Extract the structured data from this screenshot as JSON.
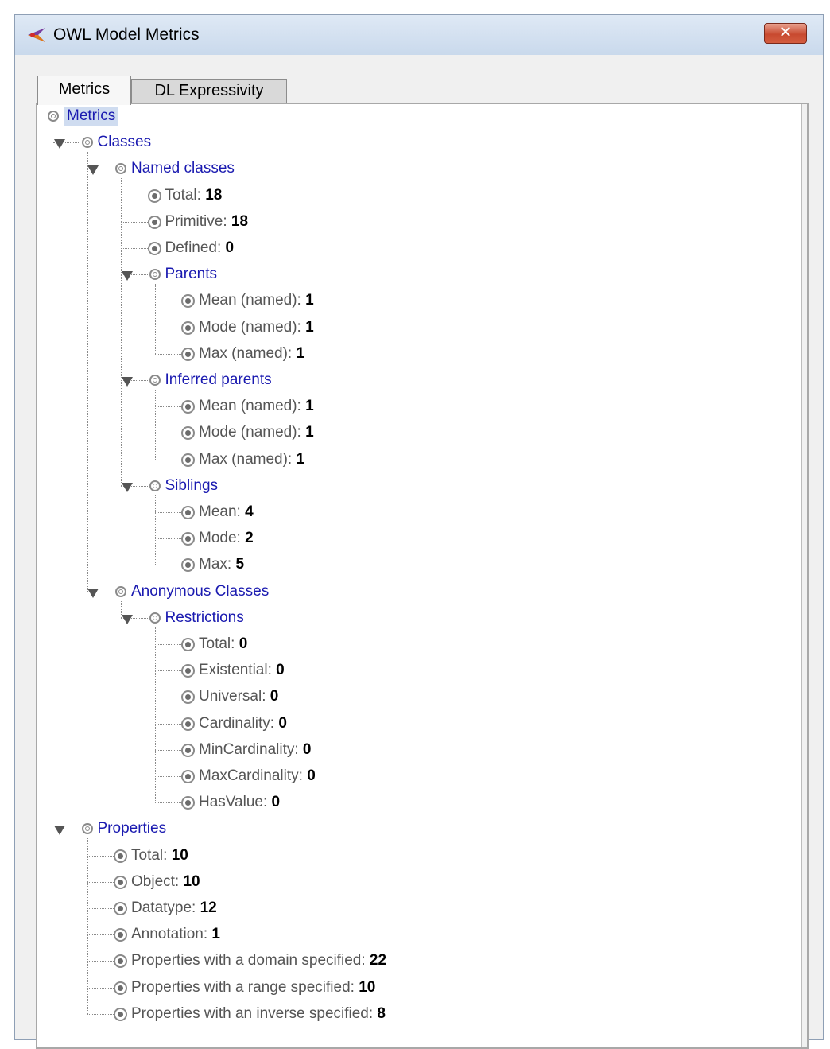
{
  "window": {
    "title": "OWL Model Metrics",
    "close_label": "✕",
    "accent_color": "#1a1ab0",
    "close_color": "#c84a30"
  },
  "tabs": [
    {
      "label": "Metrics",
      "active": true
    },
    {
      "label": "DL Expressivity",
      "active": false
    }
  ],
  "tree": [
    {
      "label": "Metrics",
      "type": "root"
    },
    {
      "label": "Classes",
      "type": "category",
      "expanded": true
    },
    {
      "label": "Named classes",
      "type": "category",
      "expanded": true
    },
    {
      "label": "Total:",
      "value": "18",
      "type": "metric"
    },
    {
      "label": "Primitive:",
      "value": "18",
      "type": "metric"
    },
    {
      "label": "Defined:",
      "value": "0",
      "type": "metric"
    },
    {
      "label": "Parents",
      "type": "category",
      "expanded": true
    },
    {
      "label": "Mean (named):",
      "value": "1",
      "type": "metric"
    },
    {
      "label": "Mode (named):",
      "value": "1",
      "type": "metric"
    },
    {
      "label": "Max (named):",
      "value": "1",
      "type": "metric"
    },
    {
      "label": "Inferred parents",
      "type": "category",
      "expanded": true
    },
    {
      "label": "Mean (named):",
      "value": "1",
      "type": "metric"
    },
    {
      "label": "Mode (named):",
      "value": "1",
      "type": "metric"
    },
    {
      "label": "Max (named):",
      "value": "1",
      "type": "metric"
    },
    {
      "label": "Siblings",
      "type": "category",
      "expanded": true
    },
    {
      "label": "Mean:",
      "value": "4",
      "type": "metric"
    },
    {
      "label": "Mode:",
      "value": "2",
      "type": "metric"
    },
    {
      "label": "Max:",
      "value": "5",
      "type": "metric"
    },
    {
      "label": "Anonymous Classes",
      "type": "category",
      "expanded": true
    },
    {
      "label": "Restrictions",
      "type": "category",
      "expanded": true
    },
    {
      "label": "Total:",
      "value": "0",
      "type": "metric"
    },
    {
      "label": "Existential:",
      "value": "0",
      "type": "metric"
    },
    {
      "label": "Universal:",
      "value": "0",
      "type": "metric"
    },
    {
      "label": "Cardinality:",
      "value": "0",
      "type": "metric"
    },
    {
      "label": "MinCardinality:",
      "value": "0",
      "type": "metric"
    },
    {
      "label": "MaxCardinality:",
      "value": "0",
      "type": "metric"
    },
    {
      "label": "HasValue:",
      "value": "0",
      "type": "metric"
    },
    {
      "label": "Properties",
      "type": "category",
      "expanded": true
    },
    {
      "label": "Total:",
      "value": "10",
      "type": "metric"
    },
    {
      "label": "Object:",
      "value": "10",
      "type": "metric"
    },
    {
      "label": "Datatype:",
      "value": "12",
      "type": "metric"
    },
    {
      "label": "Annotation:",
      "value": "1",
      "type": "metric"
    },
    {
      "label": "Properties with a domain specified:",
      "value": "22",
      "type": "metric"
    },
    {
      "label": "Properties with a range specified:",
      "value": "10",
      "type": "metric"
    },
    {
      "label": "Properties with an inverse specified:",
      "value": "8",
      "type": "metric"
    }
  ]
}
